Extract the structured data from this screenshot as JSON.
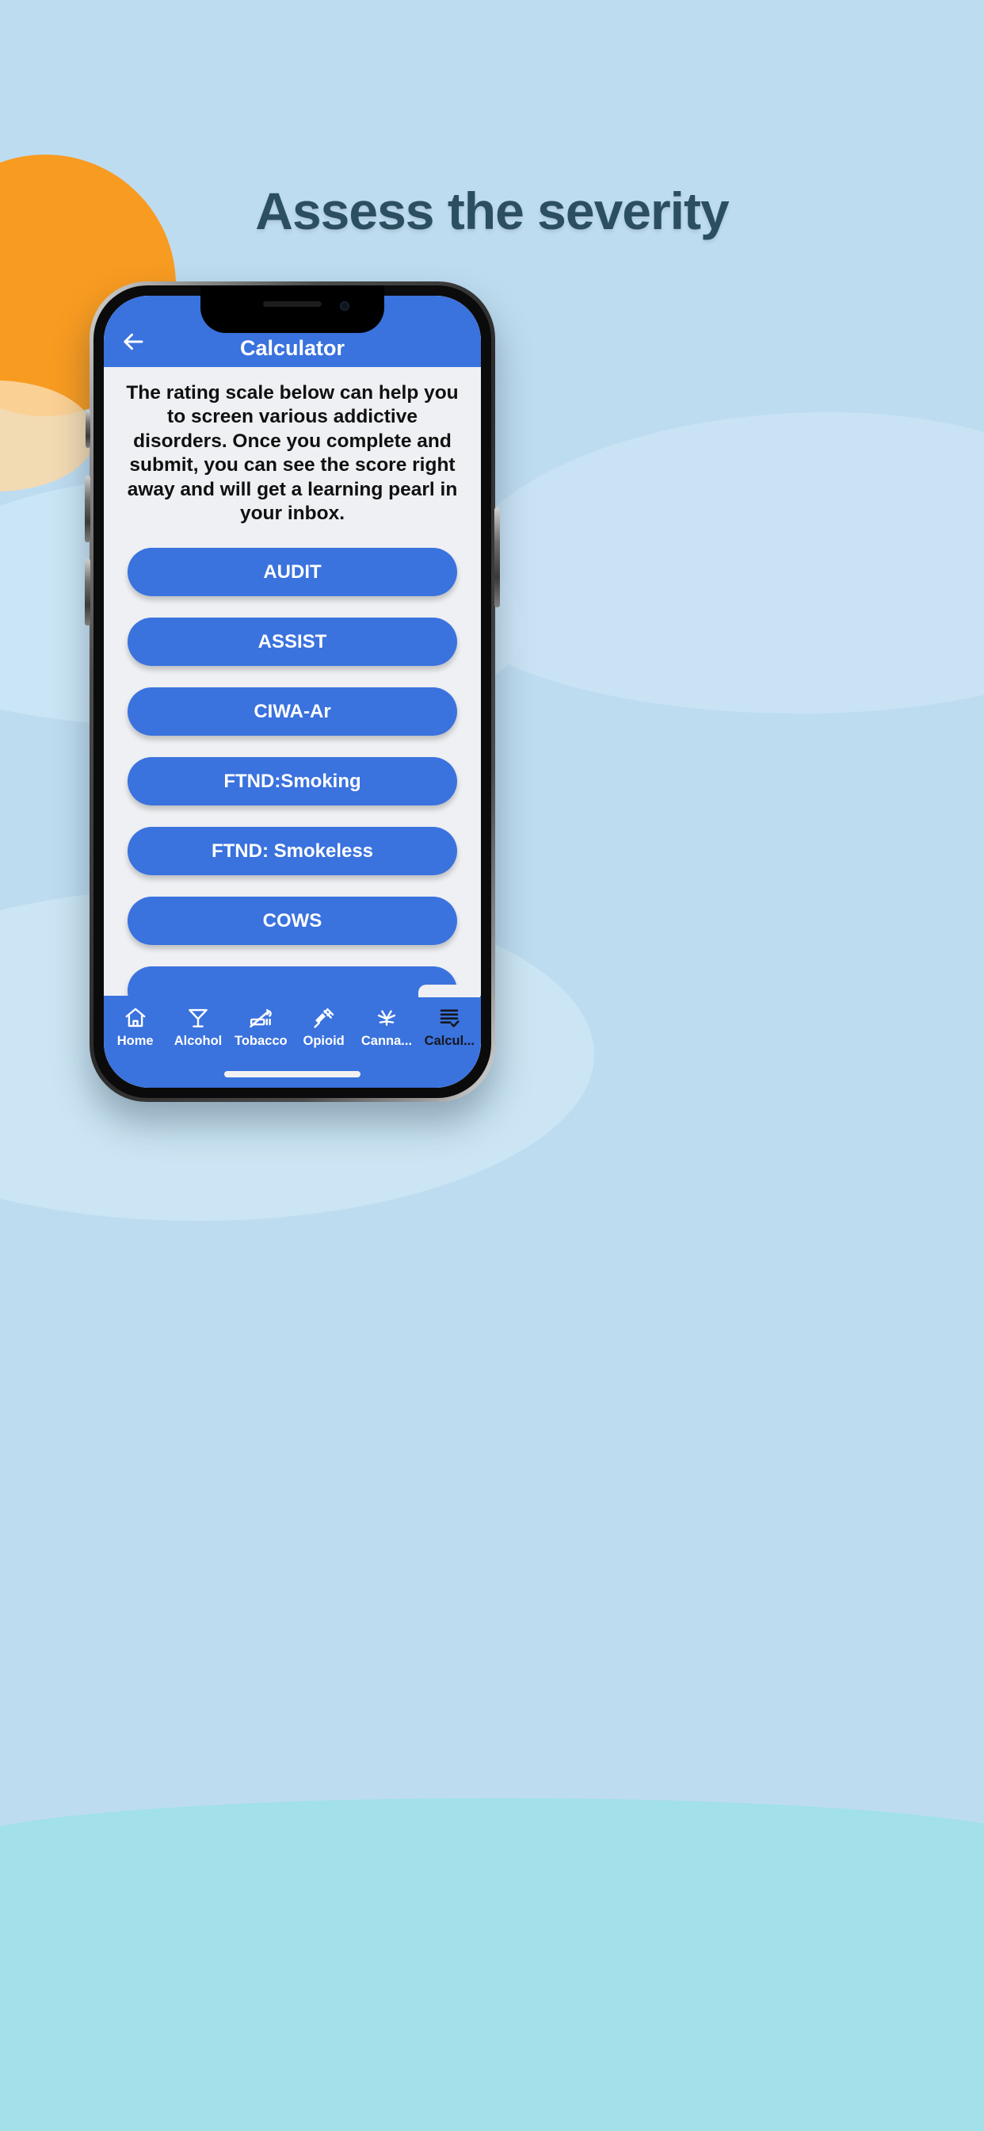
{
  "page": {
    "headline": "Assess the severity",
    "background_color": "#bedcf0",
    "sun_color": "#f89b21",
    "sea_color": "#a2e0ea",
    "headline_color": "#2c4f5f"
  },
  "app": {
    "accent_color": "#3a72de",
    "screen_background": "#eef0f3",
    "appbar": {
      "title": "Calculator",
      "back_icon": "arrow-left-icon"
    },
    "intro_text": "The rating scale below can help you to screen various addictive disorders. Once you complete and submit, you can see the score right away and will get a learning pearl in your inbox.",
    "scales": [
      {
        "label": "AUDIT"
      },
      {
        "label": "ASSIST"
      },
      {
        "label": "CIWA-Ar"
      },
      {
        "label": "FTND:Smoking"
      },
      {
        "label": "FTND: Smokeless"
      },
      {
        "label": "COWS"
      },
      {
        "label": ""
      }
    ],
    "tabs": [
      {
        "label": "Home",
        "icon": "home-icon",
        "active": false
      },
      {
        "label": "Alcohol",
        "icon": "cocktail-icon",
        "active": false
      },
      {
        "label": "Tobacco",
        "icon": "no-smoking-icon",
        "active": false
      },
      {
        "label": "Opioid",
        "icon": "syringe-icon",
        "active": false
      },
      {
        "label": "Canna...",
        "icon": "cannabis-icon",
        "active": false
      },
      {
        "label": "Calcul...",
        "icon": "checklist-icon",
        "active": true
      }
    ]
  }
}
